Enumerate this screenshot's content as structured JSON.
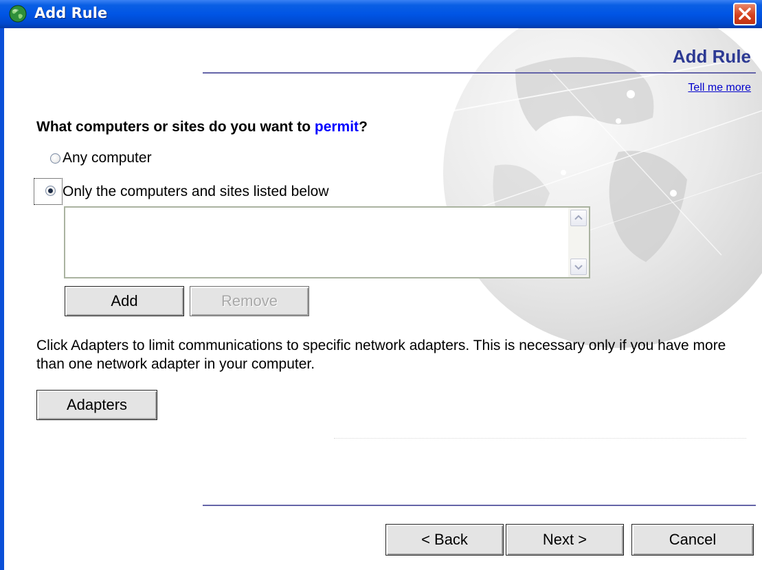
{
  "window": {
    "title": "Add Rule"
  },
  "header": {
    "title": "Add Rule",
    "help_link": "Tell me more"
  },
  "question": {
    "prefix": "What computers or sites do you want to ",
    "keyword": "permit",
    "suffix": "?"
  },
  "options": [
    {
      "label": "Any computer",
      "selected": false
    },
    {
      "label": "Only the computers and sites listed below",
      "selected": true
    }
  ],
  "sites_list": {
    "items": []
  },
  "list_buttons": {
    "add_label": "Add",
    "remove_label": "Remove"
  },
  "adapters": {
    "description": "Click Adapters to limit communications to specific network adapters. This is necessary only if you have more than one network adapter in your computer.",
    "button_label": "Adapters"
  },
  "footer": {
    "back_label": "< Back",
    "next_label": "Next >",
    "cancel_label": "Cancel"
  },
  "icons": {
    "title_icon": "globe-icon",
    "close": "close-icon",
    "scroll_up": "chevron-up-icon",
    "scroll_down": "chevron-down-icon"
  },
  "colors": {
    "titlebar": "#0055e5",
    "header_title": "#2d3a93",
    "keyword": "#0000ff",
    "link": "#0000cc",
    "close_button": "#d5411e"
  }
}
